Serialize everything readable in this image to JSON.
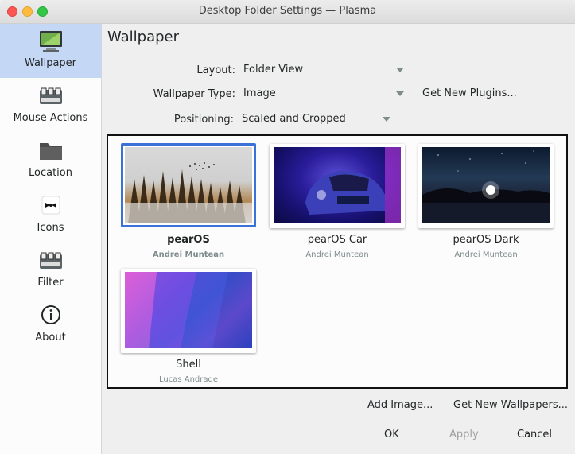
{
  "window": {
    "title": "Desktop Folder Settings — Plasma"
  },
  "sidebar": {
    "items": [
      {
        "label": "Wallpaper",
        "icon": "wallpaper-icon",
        "active": true
      },
      {
        "label": "Mouse Actions",
        "icon": "mouse-actions-icon"
      },
      {
        "label": "Location",
        "icon": "folder-icon"
      },
      {
        "label": "Icons",
        "icon": "icons-icon"
      },
      {
        "label": "Filter",
        "icon": "filter-icon"
      },
      {
        "label": "About",
        "icon": "info-icon"
      }
    ]
  },
  "main": {
    "title": "Wallpaper",
    "layout_label": "Layout:",
    "layout_value": "Folder View",
    "type_label": "Wallpaper Type:",
    "type_value": "Image",
    "get_plugins": "Get New Plugins...",
    "positioning_label": "Positioning:",
    "positioning_value": "Scaled and Cropped"
  },
  "wallpapers": [
    {
      "name": "pearOS",
      "author": "Andrei Muntean",
      "selected": true
    },
    {
      "name": "pearOS Car",
      "author": "Andrei Muntean"
    },
    {
      "name": "pearOS Dark",
      "author": "Andrei Muntean"
    },
    {
      "name": "Shell",
      "author": "Lucas Andrade"
    }
  ],
  "actions": {
    "add_image": "Add Image...",
    "get_wallpapers": "Get New Wallpapers...",
    "ok": "OK",
    "apply": "Apply",
    "cancel": "Cancel"
  },
  "colors": {
    "accent": "#3a72d8",
    "sidebar_active": "#c4d7f5"
  }
}
